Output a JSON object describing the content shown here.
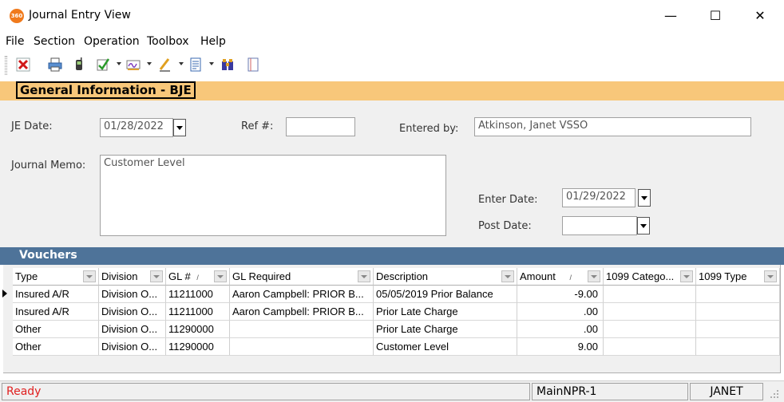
{
  "window": {
    "title": "Journal Entry View",
    "app_icon_text": "360",
    "minimize": "—",
    "maximize": "☐",
    "close": "✕"
  },
  "menu": [
    "File",
    "Section",
    "Operation",
    "Toolbox",
    "Help"
  ],
  "toolbar": {
    "icons": [
      "delete-icon",
      "print-icon",
      "phone-icon",
      "check-icon",
      "sign-icon",
      "pen-icon",
      "document-icon",
      "binoculars-icon",
      "note-icon"
    ]
  },
  "general": {
    "title": "General Information - BJE",
    "je_date_label": "JE Date:",
    "je_date_value": "01/28/2022",
    "ref_label": "Ref #:",
    "ref_value": "",
    "entered_by_label": "Entered by:",
    "entered_by_value": "Atkinson, Janet VSSO",
    "memo_label": "Journal Memo:",
    "memo_value": "Customer Level",
    "enter_date_label": "Enter Date:",
    "enter_date_value": "01/29/2022",
    "post_date_label": "Post Date:",
    "post_date_value": ""
  },
  "vouchers": {
    "title": "Vouchers",
    "columns": [
      "Type",
      "Division",
      "GL #",
      "GL Required",
      "Description",
      "Amount",
      "1099 Catego...",
      "1099 Type"
    ],
    "sort_marks": {
      "gl": "/",
      "amount": "/"
    },
    "rows": [
      {
        "type": "Insured A/R",
        "division": "Division O...",
        "gl": "11211000",
        "gl_required": "Aaron Campbell: PRIOR B...",
        "description": "05/05/2019 Prior Balance",
        "amount": "-9.00",
        "cat1099": "",
        "type1099": ""
      },
      {
        "type": "Insured A/R",
        "division": "Division O...",
        "gl": "11211000",
        "gl_required": "Aaron Campbell: PRIOR B...",
        "description": "Prior Late Charge",
        "amount": ".00",
        "cat1099": "",
        "type1099": ""
      },
      {
        "type": "Other",
        "division": "Division O...",
        "gl": "11290000",
        "gl_required": "",
        "description": "Prior Late Charge",
        "amount": ".00",
        "cat1099": "",
        "type1099": ""
      },
      {
        "type": "Other",
        "division": "Division O...",
        "gl": "11290000",
        "gl_required": "",
        "description": "Customer Level",
        "amount": "9.00",
        "cat1099": "",
        "type1099": ""
      }
    ]
  },
  "status": {
    "state": "Ready",
    "server": "MainNPR-1",
    "user": "JANET",
    "state_color": "#e02020"
  }
}
